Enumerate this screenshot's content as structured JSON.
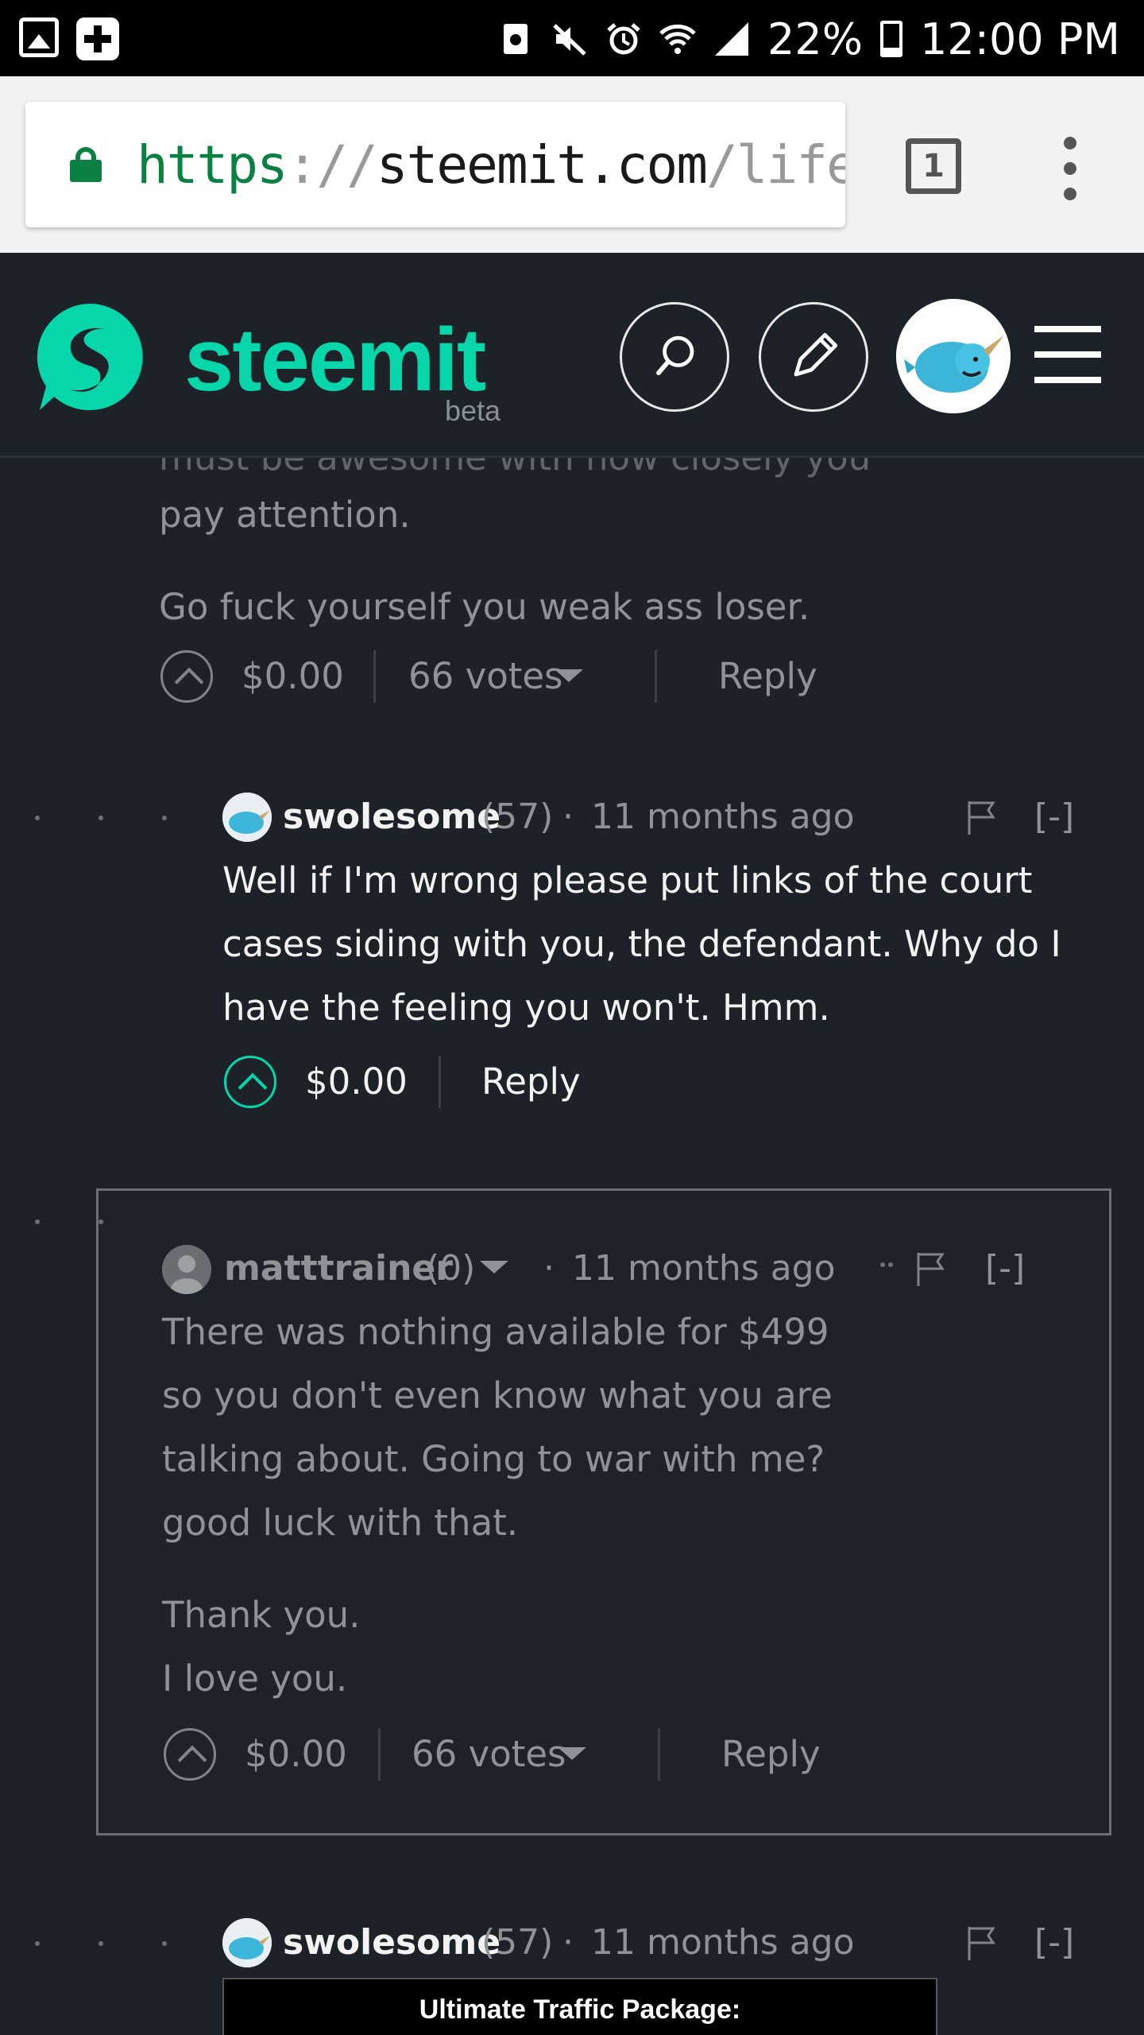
{
  "status_bar": {
    "battery": "22%",
    "time": "12:00 PM"
  },
  "browser": {
    "url_scheme": "https",
    "url_sep": "://",
    "url_host": "steemit.com",
    "url_rest": "/life,",
    "tab_count": "1"
  },
  "header": {
    "wordmark": "steemit",
    "beta": "beta"
  },
  "comments": {
    "c1": {
      "line_partial": "must be awesome with how closely you",
      "line2": "pay attention.",
      "line3": "Go fuck yourself you weak ass loser.",
      "amount": "$0.00",
      "votes": "66 votes",
      "reply": "Reply"
    },
    "c2": {
      "author": "swolesome",
      "rep": "(57)",
      "sep": "·",
      "time": "11 months ago",
      "collapse": "[-]",
      "lines": [
        "Well if I'm wrong please put links of the court",
        "cases siding with you, the defendant. Why do I",
        "have the feeling you won't. Hmm."
      ],
      "amount": "$0.00",
      "reply": "Reply"
    },
    "c3": {
      "author": "matttrainer",
      "rep": "(0)",
      "sep": "·",
      "time": "11 months ago",
      "collapse": "[-]",
      "lines": [
        "There was nothing available for $499",
        "so you don't even know what you are",
        "talking about. Going to war with me?",
        "good luck with that."
      ],
      "lines2": [
        "Thank you.",
        "I love you."
      ],
      "amount": "$0.00",
      "votes": "66 votes",
      "reply": "Reply"
    },
    "c4": {
      "author": "swolesome",
      "rep": "(57)",
      "sep": "·",
      "time": "11 months ago",
      "collapse": "[-]",
      "banner": "Ultimate Traffic Package:"
    }
  },
  "colors": {
    "accent": "#06d6a9",
    "background": "#1c2228",
    "url_secure": "#0b8043"
  },
  "icons": [
    "gallery-icon",
    "health-plus-icon",
    "mute-icon",
    "alarm-icon",
    "wifi-icon",
    "signal-icon",
    "battery-icon",
    "lock-icon",
    "tabs-icon",
    "more-vert-icon",
    "steemit-logo",
    "search-icon",
    "pencil-icon",
    "menu-icon",
    "upvote-icon",
    "flag-icon",
    "caret-down-icon"
  ]
}
